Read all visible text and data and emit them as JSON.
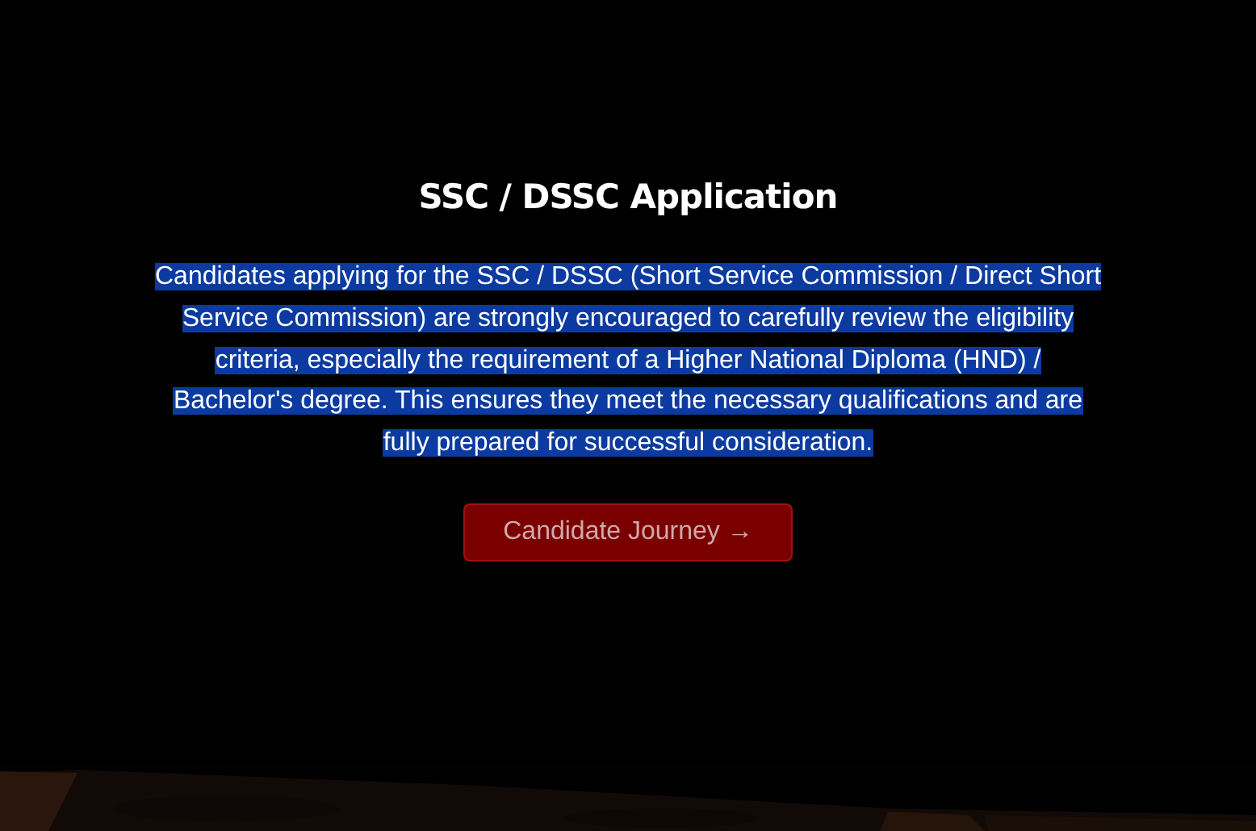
{
  "heading": "SSC / DSSC Application",
  "description": {
    "text": "Candidates applying for the SSC / DSSC (Short Service Commission / Direct Short Service Commission) are strongly encouraged to carefully review the eligibility criteria, especially the requirement of a Higher National Diploma (HND) / Bachelor's degree. This ensures they meet the necessary qualifications and are fully prepared for successful consideration.",
    "highlighted": true
  },
  "button": {
    "label": "Candidate Journey →"
  }
}
